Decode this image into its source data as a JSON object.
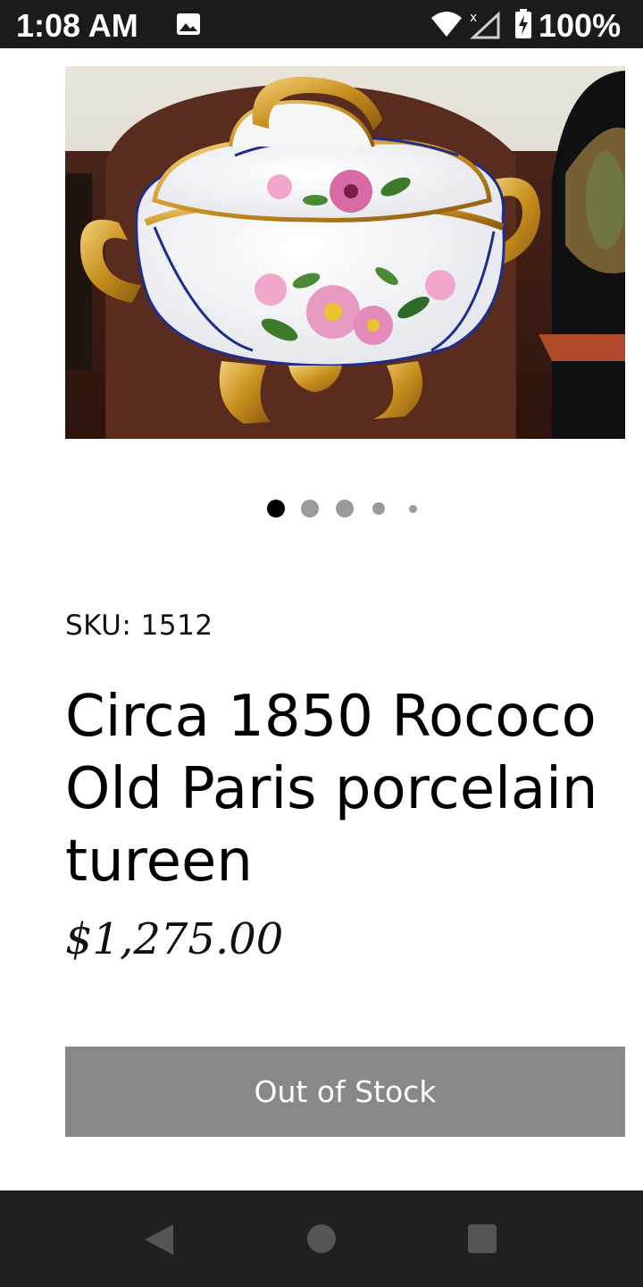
{
  "status_bar": {
    "time": "1:08 AM",
    "battery": "100%",
    "icons": [
      "gallery-icon",
      "wifi-icon",
      "signal-icon",
      "battery-charging-icon"
    ]
  },
  "product": {
    "image_alt": "Rococo Old Paris porcelain tureen with floral decoration and gilt handles",
    "carousel": {
      "count": 5,
      "active_index": 0
    },
    "sku": "SKU: 1512",
    "title": "Circa 1850 Rococo Old Paris porcelain tureen",
    "price": "$1,275.00",
    "stock_button": "Out of Stock"
  },
  "nav_bar": {
    "icons": [
      "back-icon",
      "home-icon",
      "recents-icon"
    ]
  },
  "colors": {
    "status_bar": "#1b1b1b",
    "nav_bar": "#202020",
    "button_bg": "#888888",
    "dot_active": "#000000",
    "dot_inactive": "#9a9a9a"
  }
}
